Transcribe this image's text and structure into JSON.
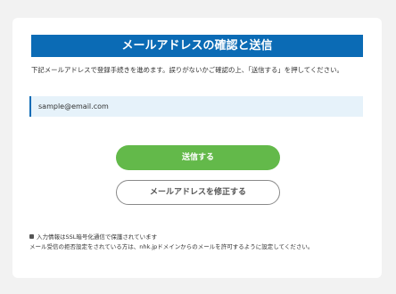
{
  "header": {
    "title": "メールアドレスの確認と送信"
  },
  "lead": {
    "text": "下記メールアドレスで登録手続きを進めます。誤りがないかご確認の上、「送信する」を押してください。"
  },
  "email": {
    "value": "sample@email.com"
  },
  "buttons": {
    "send": "送信する",
    "edit": "メールアドレスを修正する"
  },
  "notes": {
    "ssl": "入力情報はSSL暗号化通信で保護されています",
    "filter": "メール受信の拒否設定をされている方は、nhk.jpドメインからのメールを許可するように設定してください。"
  },
  "colors": {
    "header_bg": "#0b6bb5",
    "send_button": "#63b94a",
    "email_box_bg": "#e6f2fa"
  },
  "icons": [
    "lock-icon"
  ]
}
